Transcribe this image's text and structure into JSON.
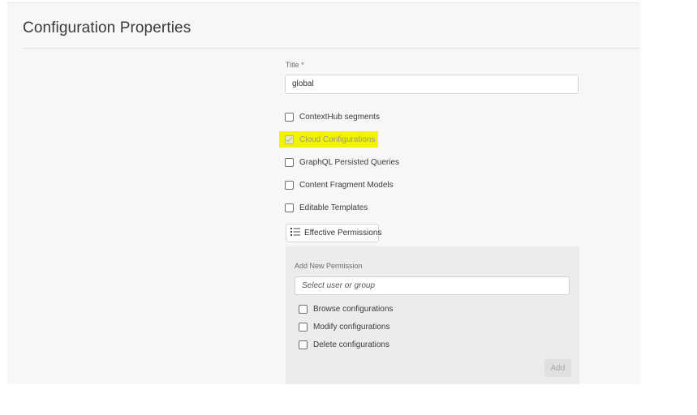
{
  "header": {
    "title": "Configuration Properties"
  },
  "form": {
    "title_label": "Title *",
    "title_value": "global",
    "options": [
      {
        "label": "ContextHub segments",
        "checked": false,
        "disabled": false
      },
      {
        "label": "Cloud Configurations",
        "checked": true,
        "disabled": true,
        "highlighted": true
      },
      {
        "label": "GraphQL Persisted Queries",
        "checked": false,
        "disabled": false
      },
      {
        "label": "Content Fragment Models",
        "checked": false,
        "disabled": false
      },
      {
        "label": "Editable Templates",
        "checked": false,
        "disabled": false
      }
    ]
  },
  "permissions": {
    "button_label": "Effective Permissions",
    "button_icon": "list-icon",
    "add_new_label": "Add New Permission",
    "user_placeholder": "Select user or group",
    "checkboxes": [
      {
        "label": "Browse configurations",
        "checked": false
      },
      {
        "label": "Modify configurations",
        "checked": false
      },
      {
        "label": "Delete configurations",
        "checked": false
      }
    ],
    "add_label": "Add",
    "add_disabled": true
  },
  "colors": {
    "highlight": "#f2f300",
    "panel_background": "#f7f7f7",
    "permission_panel_background": "#ececec"
  }
}
